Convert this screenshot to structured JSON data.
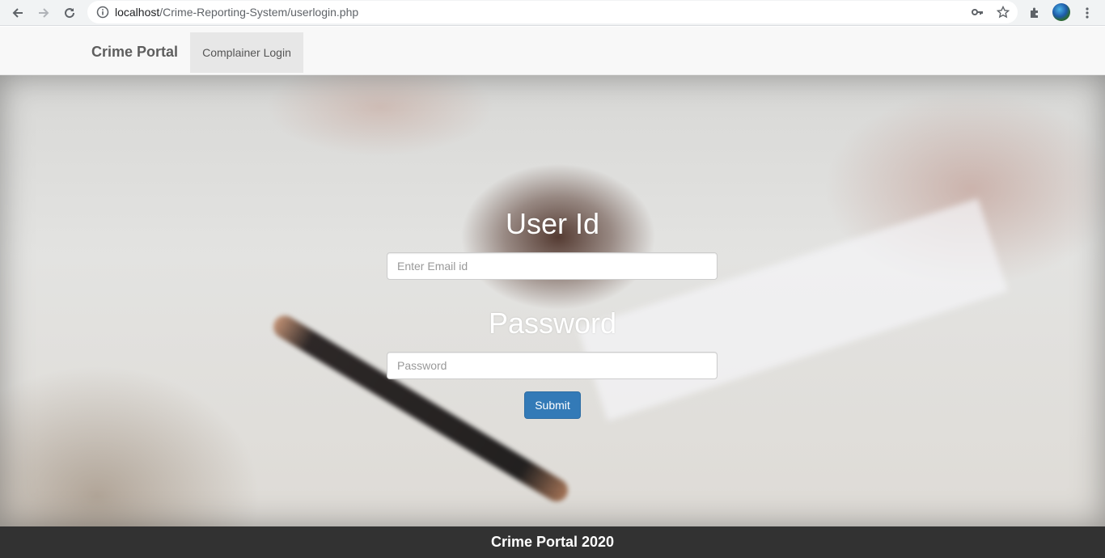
{
  "browser": {
    "url_host": "localhost",
    "url_path": "/Crime-Reporting-System/userlogin.php"
  },
  "navbar": {
    "brand": "Crime Portal",
    "items": [
      {
        "label": "Complainer Login"
      }
    ]
  },
  "form": {
    "user_label": "User Id",
    "user_placeholder": "Enter Email id",
    "password_label": "Password",
    "password_placeholder": "Password",
    "submit_label": "Submit"
  },
  "footer": {
    "text": "Crime Portal 2020"
  },
  "colors": {
    "primary_button": "#337ab7",
    "navbar_bg": "#f8f8f8",
    "footer_bg": "#222222"
  }
}
